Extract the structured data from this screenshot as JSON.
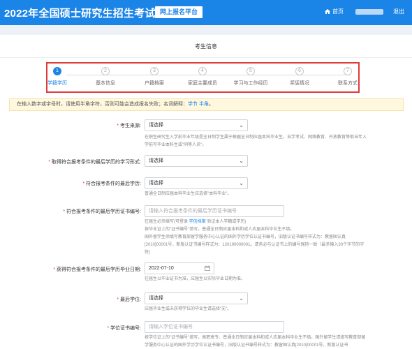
{
  "header": {
    "title": "2022年全国硕士研究生招生考试",
    "badge": "网上报名平台",
    "home": "首页",
    "logout": "退出",
    "bg_color": "#1b84e7"
  },
  "card": {
    "title": "考生信息"
  },
  "stepper": {
    "active_index": 0,
    "steps": [
      {
        "num": "1",
        "label": "学籍学历"
      },
      {
        "num": "2",
        "label": "基本信息"
      },
      {
        "num": "3",
        "label": "户籍档案"
      },
      {
        "num": "4",
        "label": "家庭主要成员"
      },
      {
        "num": "5",
        "label": "学习与工作经历"
      },
      {
        "num": "6",
        "label": "奖惩情况"
      },
      {
        "num": "7",
        "label": "联系方式"
      }
    ],
    "highlight_color": "#e03b3b"
  },
  "notice": {
    "text": "在输入数字或字母时，请使用半角字符，否则可能会造成报名失败；名词解释：",
    "links": [
      "学节",
      "半角"
    ],
    "end": "。"
  },
  "form": {
    "source": {
      "label": "考生来源:",
      "value": "请选择",
      "hint": "在职生研究生入学前毕业年级是全日制学生属于根据全日制应届本科毕业生，自学考试、网络教育、开放教育等取当年入学前可毕业本科生或\"同等人员\"。"
    },
    "study_form": {
      "label": "取得符合报考条件的最后学历的学习形式:",
      "value": "请选择"
    },
    "last_degree": {
      "label": "符合报考条件的最后学历:",
      "value": "请选择",
      "hint": "普通全日制应届本科毕业生应选择\"本科毕业\"。"
    },
    "cert_no": {
      "label": "符合报考条件的最后学历证书编号:",
      "placeholder": "请输入符合报考条件的最后学历证书编号",
      "hint_pre": "往届生必须填写(可登录 ",
      "hint_link": "学信档案",
      "hint_post": " 验证本人学籍或学历)",
      "hint_lines": [
        "按毕业证上的\"证书编号\"填写。普通全日制应届本科和成人应届本科毕业生不填。",
        "国外留学生须填写教育部留学服务中心认证的国外学历学位认证书编号，旧版认证书编号样式为：教留国认真[2010]00001号，新版认证书编号样式为：120190000001。请务必与认证书上的编号保持一致（最多输入30个字节的字符)"
      ]
    },
    "grad_date": {
      "label": "获得符合报考条件的最后学历毕业日期:",
      "value": "2022-07-10",
      "hint": "往届生以毕业证书为准，应届生以实际毕业日期为准。"
    },
    "last_degree_level": {
      "label": "最后学位:",
      "value": "请选择",
      "hint": "应届毕业生或未获得学位的毕业生请选择\"无\"。"
    },
    "degree_cert": {
      "label": "学位证书编号:",
      "placeholder": "请输入学位证书编号",
      "hint_lines": [
        "按学位证上的\"证书编号\"填写，高职高专、普通全日制应届本科和成人应届本科毕业生不填。国外留学生请填写教育部留学服务中心认证的国外学历学位认证书编号，旧版认证书编号样式为：教留国认真[2010]00001号。新版认证书"
      ]
    }
  }
}
